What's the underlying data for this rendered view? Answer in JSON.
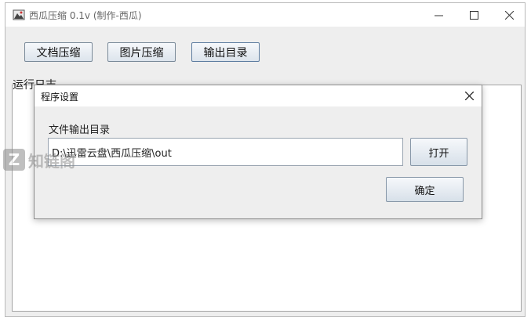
{
  "window": {
    "title": "西瓜压缩 0.1v (制作-西瓜)",
    "minimize_glyph": "—",
    "maximize_glyph": "☐",
    "close_glyph": "✕"
  },
  "toolbar": {
    "doc_compress_label": "文档压缩",
    "img_compress_label": "图片压缩",
    "output_dir_label": "输出目录"
  },
  "log": {
    "label": "运行日志"
  },
  "dialog": {
    "title": "程序设置",
    "close_glyph": "✕",
    "field_label": "文件输出目录",
    "path_value": "D:\\迅雷云盘\\西瓜压缩\\out",
    "open_label": "打开",
    "ok_label": "确定"
  },
  "watermark": {
    "mark": "Z",
    "text": "知链阁"
  },
  "icons": {
    "app": "app-icon",
    "close": "close-icon",
    "minimize": "minimize-icon",
    "maximize": "maximize-icon"
  },
  "colors": {
    "window_bg": "#eeeeee",
    "button_border": "#7a8a99",
    "focused_border": "#5e7da0"
  }
}
